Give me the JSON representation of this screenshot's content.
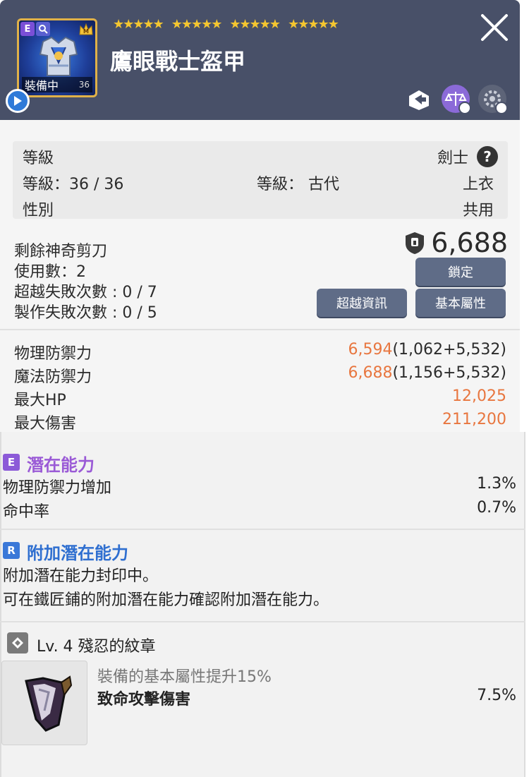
{
  "header": {
    "item_name": "鷹眼戰士盔甲",
    "equipped_label": "裝備中",
    "item_level_badge": "36",
    "badge_e": "E",
    "badge_q": "Q",
    "star_groups": [
      "★★★★★",
      "★★★★★",
      "★★★★★",
      "★★★★★"
    ],
    "close_label": "✕"
  },
  "info": {
    "level_label": "等級",
    "job": "劍士",
    "level_value": "等級：36 / 36",
    "grade": "等級： 古代",
    "slot": "上衣",
    "gender_label": "性別",
    "gender_value": "共用",
    "help": "?"
  },
  "scissors": {
    "remaining_label": "剩餘神奇剪刀",
    "price": "6,688",
    "uses": "使用數：2",
    "transcend_fail": "超越失敗次數 : 0 / 7",
    "craft_fail": "製作失敗次數 : 0 / 5",
    "lock_button": "鎖定",
    "transcend_info_button": "超越資訊",
    "base_attr_button": "基本屬性"
  },
  "stats": [
    {
      "label": "物理防禦力",
      "highlight": "6,594",
      "rest": "(1,062+5,532)"
    },
    {
      "label": "魔法防禦力",
      "highlight": "6,688",
      "rest": "(1,156+5,532)"
    },
    {
      "label": "最大HP",
      "highlight": "12,025",
      "rest": ""
    },
    {
      "label": "最大傷害",
      "highlight": "211,200",
      "rest": ""
    }
  ],
  "potential": {
    "tag": "E",
    "title": "潛在能力",
    "lines": [
      {
        "label": "物理防禦力增加",
        "value": "1.3%"
      },
      {
        "label": "命中率",
        "value": "0.7%"
      }
    ]
  },
  "additional_potential": {
    "tag": "R",
    "title": "附加潛在能力",
    "line1": "附加潛在能力封印中。",
    "line2": "可在鐵匠鋪的附加潛在能力確認附加潛在能力。"
  },
  "emblem": {
    "title": "Lv. 4 殘忍的紋章",
    "desc": "裝備的基本屬性提升15%",
    "stat_label": "致命攻擊傷害",
    "stat_value": "7.5%"
  },
  "colors": {
    "header_bg": "#485068",
    "accent_orange": "#e8763f",
    "epic_purple": "#9a5ad6",
    "rare_blue": "#2f6fd0",
    "button_bg": "#5f6c87"
  }
}
